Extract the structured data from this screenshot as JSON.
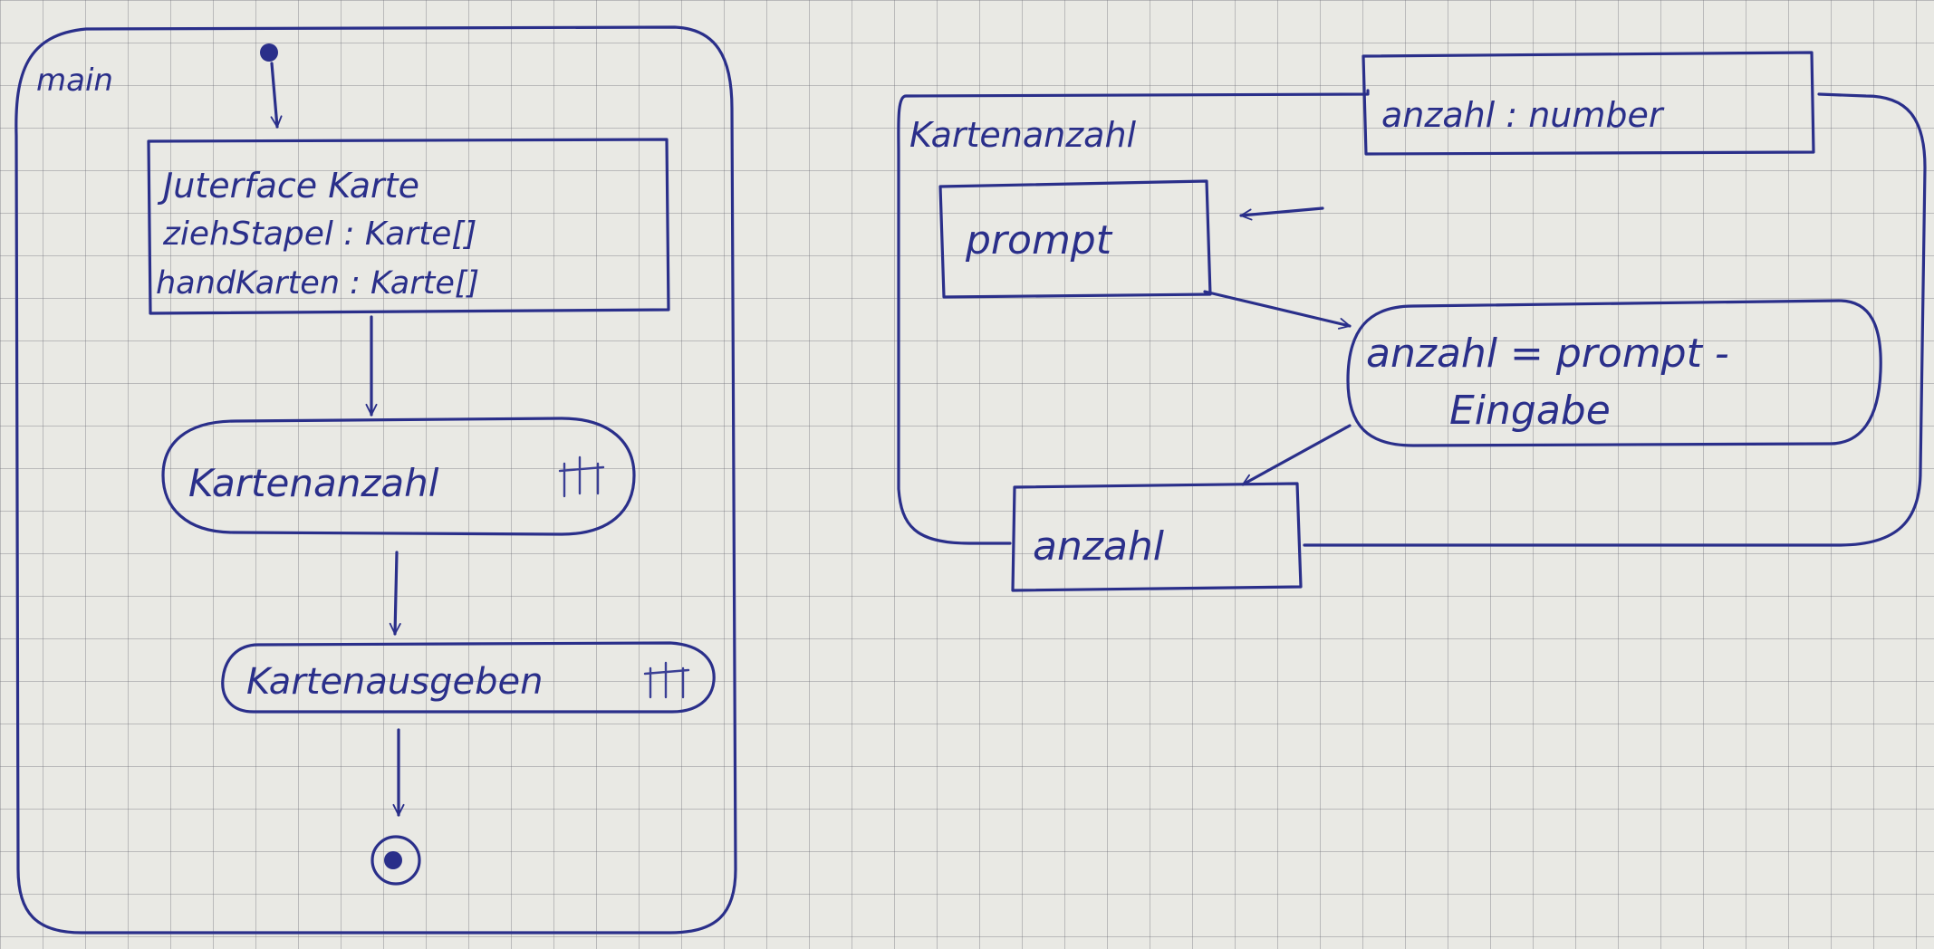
{
  "main": {
    "frame_label": "main",
    "interface_box": {
      "title": "Juterface Karte",
      "field_1": "ziehStapel : Karte[]",
      "field_2": "handKarten : Karte[]"
    },
    "action_1": "Kartenanzahl",
    "action_2": "Kartenausgeben"
  },
  "kartenanzahl": {
    "frame_label": "Kartenanzahl",
    "param_in": "anzahl : number",
    "node_prompt": "prompt",
    "action_line_1": "anzahl = prompt -",
    "action_line_2": "Eingabe",
    "param_out": "anzahl"
  },
  "colors": {
    "ink": "#2a2f8a",
    "paper": "#e9e9e4",
    "grid": "#8a8a95"
  }
}
